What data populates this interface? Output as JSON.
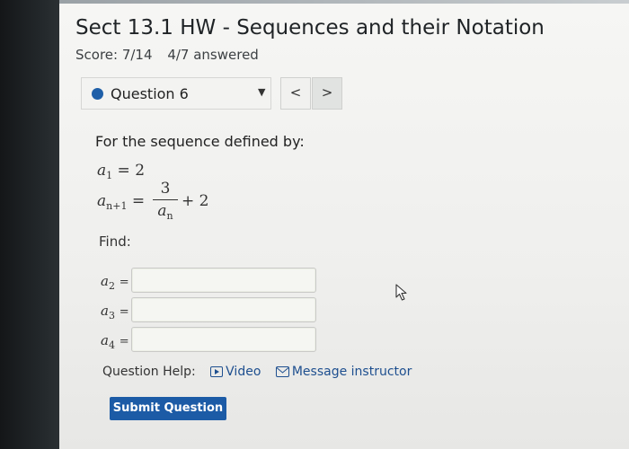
{
  "header": {
    "title": "Sect 13.1 HW - Sequences and their Notation",
    "score": "Score: 7/14",
    "answered": "4/7 answered"
  },
  "question_nav": {
    "current": "Question 6",
    "prev_label": "<",
    "next_label": ">"
  },
  "problem": {
    "prompt": "For the sequence defined by:",
    "a1_name": "a",
    "a1_sub": "1",
    "a1_value": "= 2",
    "recur_lhs_name": "a",
    "recur_lhs_sub": "n+1",
    "recur_eq": "=",
    "numerator": "3",
    "denominator_name": "a",
    "denominator_sub": "n",
    "recur_tail": "+ 2",
    "find_label": "Find:"
  },
  "answers": [
    {
      "name": "a",
      "sub": "2",
      "eq": "=",
      "value": ""
    },
    {
      "name": "a",
      "sub": "3",
      "eq": "=",
      "value": ""
    },
    {
      "name": "a",
      "sub": "4",
      "eq": "=",
      "value": ""
    }
  ],
  "help": {
    "label": "Question Help:",
    "video": "Video",
    "message": "Message instructor"
  },
  "submit_label": "Submit Question",
  "colors": {
    "accent": "#1c5ba6",
    "link": "#1e4f8f",
    "status_dot": "#1f5fa8"
  }
}
